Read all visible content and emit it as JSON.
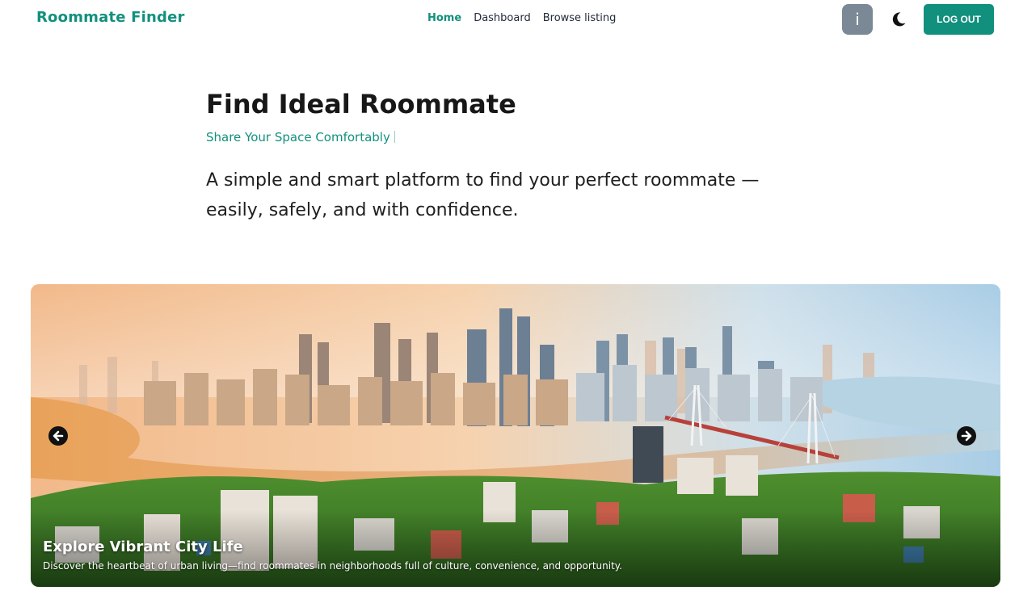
{
  "navbar": {
    "brand": "Roommate Finder",
    "links": [
      {
        "label": "Home",
        "active": true
      },
      {
        "label": "Dashboard",
        "active": false
      },
      {
        "label": "Browse listing",
        "active": false
      }
    ],
    "avatar_letter": "i",
    "theme_icon": "moon-icon",
    "logout_label": "LOG OUT"
  },
  "hero": {
    "title": "Find Ideal Roommate",
    "subtitle": "Share Your Space Comfortably",
    "description": "A simple and smart platform to find your perfect roommate — easily, safely, and with confidence."
  },
  "carousel": {
    "slide_title": "Explore Vibrant City Life",
    "slide_text": "Discover the heartbeat of urban living—find roommates in neighborhoods full of culture, convenience, and opportunity.",
    "prev_icon": "arrow-left-icon",
    "next_icon": "arrow-right-icon"
  },
  "colors": {
    "accent": "#12907e",
    "avatar_bg": "#7a8995",
    "text_dark": "#171717"
  }
}
